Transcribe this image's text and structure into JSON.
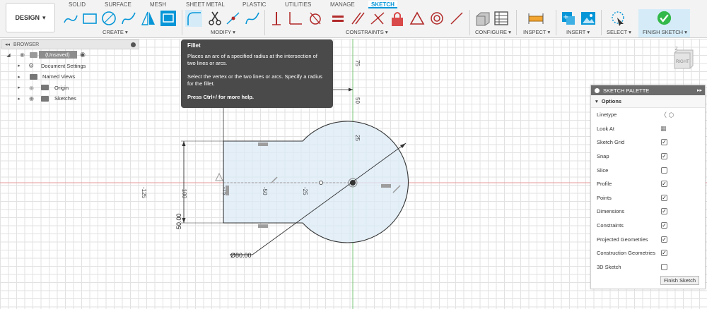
{
  "workspace": {
    "label": "DESIGN"
  },
  "tabs": [
    "SOLID",
    "SURFACE",
    "MESH",
    "SHEET METAL",
    "PLASTIC",
    "UTILITIES",
    "MANAGE",
    "SKETCH"
  ],
  "active_tab": "SKETCH",
  "groups": {
    "create": "CREATE ▾",
    "modify": "MODIFY ▾",
    "constraints": "CONSTRAINTS ▾",
    "configure": "CONFIGURE ▾",
    "inspect": "INSPECT ▾",
    "insert": "INSERT ▾",
    "select": "SELECT ▾",
    "finish": "FINISH SKETCH ▾"
  },
  "accent_color": "#0696d7",
  "finish_color": "#33b84a",
  "browser": {
    "title": "BROWSER",
    "document": "(Unsaved)",
    "items": [
      "Document Settings",
      "Named Views",
      "Origin",
      "Sketches"
    ]
  },
  "tooltip": {
    "title": "Fillet",
    "line1": "Places an arc of a specified radius at the intersection of two lines or arcs.",
    "line2": "Select the vertex or the two lines or arcs. Specify a radius for the fillet.",
    "line3": "Press Ctrl+/ for more help."
  },
  "viewcube": {
    "face": "RIGHT"
  },
  "dimensions": {
    "diameter": "Ø80.00",
    "height": "50.00",
    "ruler_v": [
      "75",
      "50",
      "25"
    ],
    "ruler_h": [
      "-125",
      "-100",
      "-75",
      "-50",
      "-25"
    ]
  },
  "palette": {
    "title": "SKETCH PALETTE",
    "options_label": "Options",
    "rows": [
      {
        "label": "Linetype",
        "kind": "icon"
      },
      {
        "label": "Look At",
        "kind": "icon"
      },
      {
        "label": "Sketch Grid",
        "kind": "checkbox",
        "checked": true
      },
      {
        "label": "Snap",
        "kind": "checkbox",
        "checked": true
      },
      {
        "label": "Slice",
        "kind": "checkbox",
        "checked": false
      },
      {
        "label": "Profile",
        "kind": "checkbox",
        "checked": true
      },
      {
        "label": "Points",
        "kind": "checkbox",
        "checked": true
      },
      {
        "label": "Dimensions",
        "kind": "checkbox",
        "checked": true
      },
      {
        "label": "Constraints",
        "kind": "checkbox",
        "checked": true
      },
      {
        "label": "Projected Geometries",
        "kind": "checkbox",
        "checked": true
      },
      {
        "label": "Construction Geometries",
        "kind": "checkbox",
        "checked": true
      },
      {
        "label": "3D Sketch",
        "kind": "checkbox",
        "checked": false
      }
    ],
    "finish_button": "Finish Sketch"
  }
}
